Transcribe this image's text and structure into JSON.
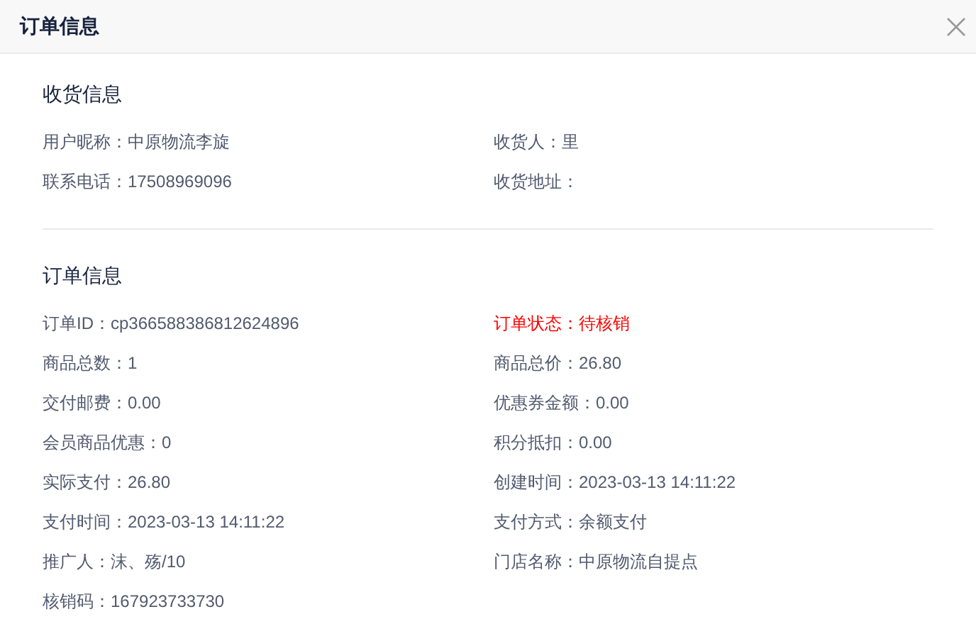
{
  "window": {
    "title": "订单信息"
  },
  "sections": [
    {
      "title": "收货信息",
      "fields": [
        {
          "text": "用户昵称：中原物流李旋",
          "alert": false
        },
        {
          "text": "收货人：里",
          "alert": false
        },
        {
          "text": "联系电话：17508969096",
          "alert": false
        },
        {
          "text": "收货地址：",
          "alert": false
        }
      ]
    },
    {
      "title": "订单信息",
      "fields": [
        {
          "text": "订单ID：cp366588386812624896",
          "alert": false
        },
        {
          "text": "订单状态：待核销",
          "alert": true
        },
        {
          "text": "商品总数：1",
          "alert": false
        },
        {
          "text": "商品总价：26.80",
          "alert": false
        },
        {
          "text": "交付邮费：0.00",
          "alert": false
        },
        {
          "text": "优惠券金额：0.00",
          "alert": false
        },
        {
          "text": "会员商品优惠：0",
          "alert": false
        },
        {
          "text": "积分抵扣：0.00",
          "alert": false
        },
        {
          "text": "实际支付：26.80",
          "alert": false
        },
        {
          "text": "创建时间：2023-03-13 14:11:22",
          "alert": false
        },
        {
          "text": "支付时间：2023-03-13 14:11:22",
          "alert": false
        },
        {
          "text": "支付方式：余额支付",
          "alert": false
        },
        {
          "text": "推广人：沫、殇/10",
          "alert": false
        },
        {
          "text": "门店名称：中原物流自提点",
          "alert": false
        },
        {
          "text": "核销码：167923733730",
          "alert": false
        }
      ]
    }
  ]
}
